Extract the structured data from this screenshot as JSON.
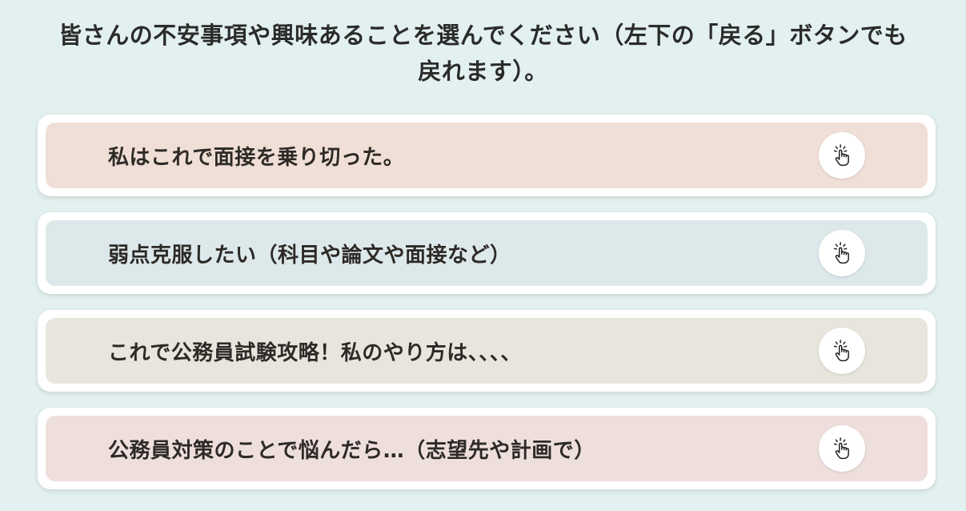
{
  "question": {
    "line1": "皆さんの不安事項や興味あることを選んでください（左下の「戻る」ボタンでも",
    "line2": "戻れます）。"
  },
  "options": [
    {
      "label": "私はこれで面接を乗り切った。",
      "bg_color": "#f0dfd6",
      "icon": "tap-hand-icon"
    },
    {
      "label": "弱点克服したい（科目や論文や面接など）",
      "bg_color": "#dde8ea",
      "icon": "tap-hand-icon"
    },
    {
      "label": "これで公務員試験攻略！私のやり方は、、、、",
      "bg_color": "#e7e5dc",
      "icon": "tap-hand-icon"
    },
    {
      "label": "公務員対策のことで悩んだら…（志望先や計画で）",
      "bg_color": "#eedfdd",
      "icon": "tap-hand-icon"
    }
  ],
  "colors": {
    "page_background": "#e2f0ef",
    "card_border": "#ffffff",
    "text": "#2d2a27"
  }
}
